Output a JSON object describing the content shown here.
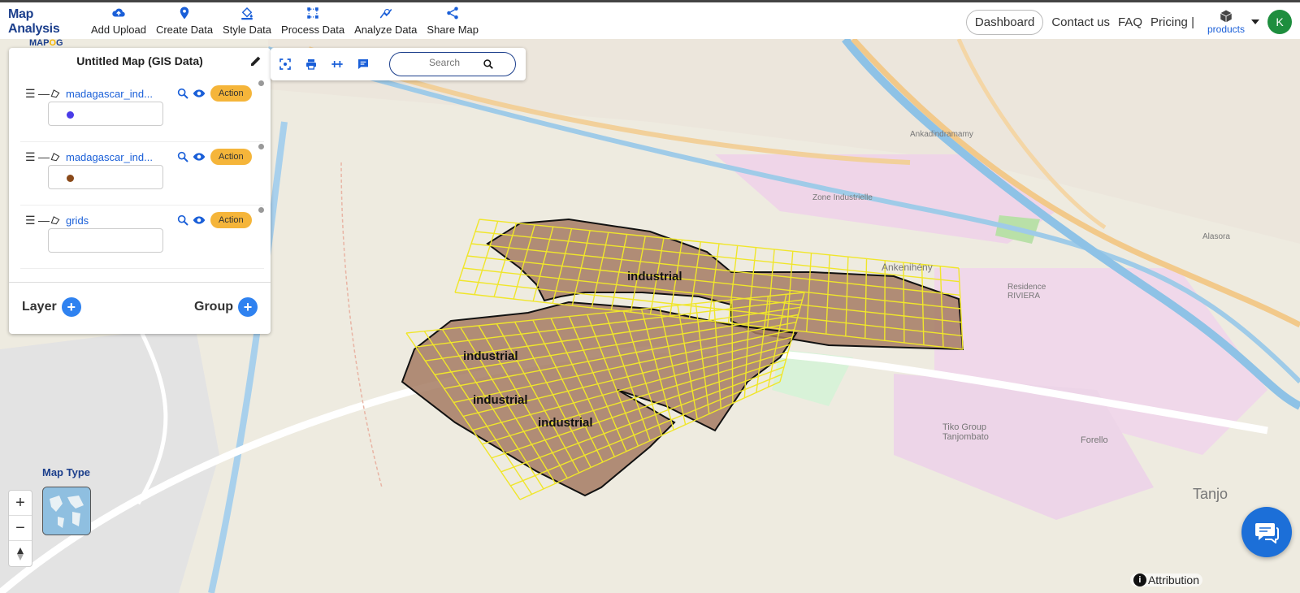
{
  "brand": {
    "title": "Map Analysis",
    "subtitle_a": "MAP",
    "subtitle_o": "O",
    "subtitle_b": "G"
  },
  "nav": [
    {
      "label": "Add Upload",
      "icon": "cloud-upload-icon"
    },
    {
      "label": "Create Data",
      "icon": "location-pin-icon"
    },
    {
      "label": "Style Data",
      "icon": "paint-bucket-icon"
    },
    {
      "label": "Process Data",
      "icon": "process-nodes-icon"
    },
    {
      "label": "Analyze Data",
      "icon": "analyze-chart-icon"
    },
    {
      "label": "Share Map",
      "icon": "share-icon"
    }
  ],
  "header_right": {
    "dashboard": "Dashboard",
    "contact": "Contact us",
    "faq": "FAQ",
    "pricing": "Pricing |",
    "products": "products",
    "avatar": "K"
  },
  "panel": {
    "title": "Untitled Map (GIS Data)",
    "layers": [
      {
        "name": "madagascar_ind...",
        "action": "Action",
        "color": "#4a3ce8"
      },
      {
        "name": "madagascar_ind...",
        "action": "Action",
        "color": "#8a4a1a"
      },
      {
        "name": "grids",
        "action": "Action",
        "color": ""
      }
    ],
    "layer_label": "Layer",
    "group_label": "Group"
  },
  "tools": {
    "search_placeholder": "Search"
  },
  "map": {
    "labels": [
      "industrial",
      "industrial",
      "industrial",
      "industrial"
    ],
    "places": [
      "Ankenihény",
      "Tiko Group Tanjombato",
      "Forello",
      "Tanjo",
      "Zone Industrielle",
      "Residence RIVIERA",
      "Ankadindramamy",
      "Alasora"
    ],
    "map_type_label": "Map Type",
    "zoom_in": "+",
    "zoom_out": "−",
    "attribution": "Attribution"
  },
  "colors": {
    "accent": "#1c3f8c",
    "action": "#f5b53a",
    "industrial_fill": "#a47b63",
    "grid": "#f0e62a"
  }
}
